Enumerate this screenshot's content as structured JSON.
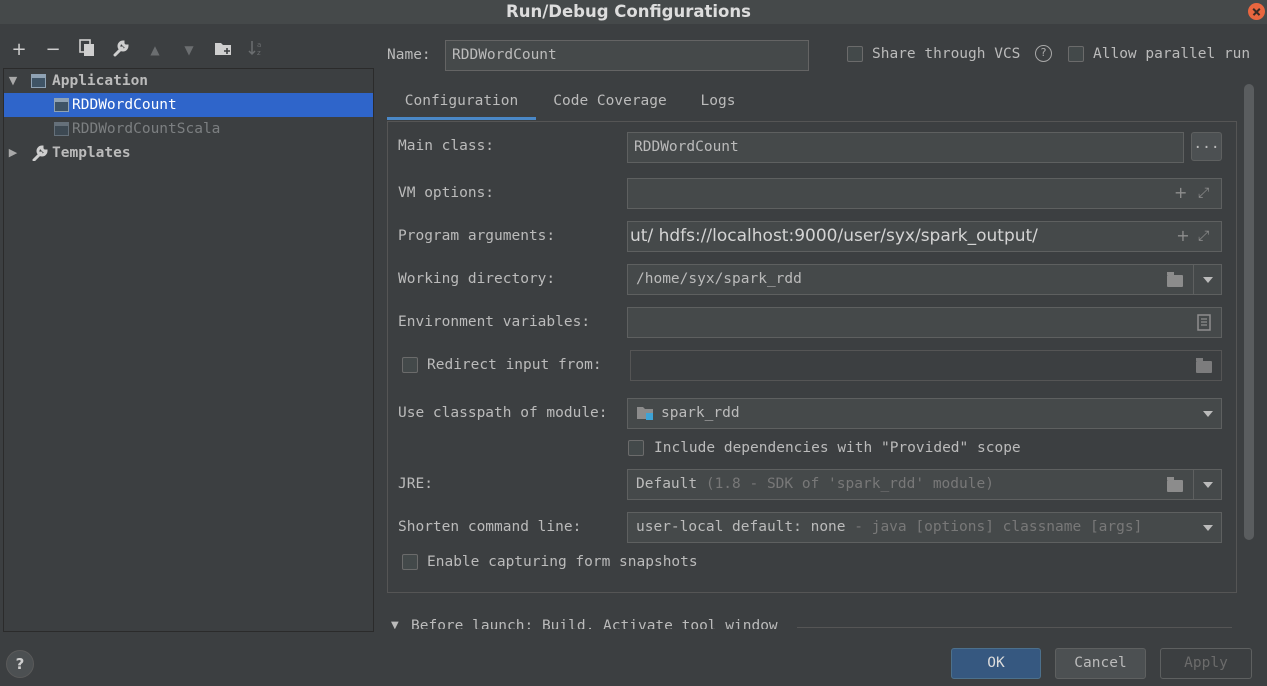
{
  "window": {
    "title": "Run/Debug Configurations"
  },
  "toolbar": {
    "icons": [
      "add-icon",
      "remove-icon",
      "copy-icon",
      "wrench-icon",
      "move-up-icon",
      "move-down-icon",
      "new-folder-icon",
      "sort-icon"
    ]
  },
  "tree": {
    "application_label": "Application",
    "items": [
      {
        "label": "RDDWordCount",
        "selected": true
      },
      {
        "label": "RDDWordCountScala",
        "selected": false
      }
    ],
    "templates_label": "Templates"
  },
  "name_row": {
    "label": "Name:",
    "value": "RDDWordCount",
    "share_vcs_label": "Share through VCS",
    "allow_parallel_label": "Allow parallel run"
  },
  "tabs": [
    {
      "label": "Configuration",
      "active": true
    },
    {
      "label": "Code Coverage",
      "active": false
    },
    {
      "label": "Logs",
      "active": false
    }
  ],
  "form": {
    "main_class_label": "Main class:",
    "main_class_value": "RDDWordCount",
    "browse_label": "...",
    "vm_options_label": "VM options:",
    "vm_options_value": "",
    "program_arguments_label": "Program arguments:",
    "program_arguments_value": "ut/ hdfs://localhost:9000/user/syx/spark_output/",
    "working_directory_label": "Working directory:",
    "working_directory_value": "/home/syx/spark_rdd",
    "env_vars_label": "Environment variables:",
    "env_vars_value": "",
    "redirect_input_label": "Redirect input from:",
    "classpath_label": "Use classpath of module:",
    "classpath_value": "spark_rdd",
    "include_deps_label": "Include dependencies with \"Provided\" scope",
    "jre_label": "JRE:",
    "jre_value": "Default",
    "jre_hint": "(1.8 - SDK of 'spark_rdd' module)",
    "shorten_label": "Shorten command line:",
    "shorten_value": "user-local default: none",
    "shorten_hint": "- java [options] classname [args]",
    "snapshots_label": "Enable capturing form snapshots"
  },
  "before_launch": {
    "label": "Before launch: Build, Activate tool window"
  },
  "buttons": {
    "ok": "OK",
    "cancel": "Cancel",
    "apply": "Apply",
    "help": "?"
  },
  "colors": {
    "selection": "#2f65ca",
    "tab_underline": "#4a88c7",
    "primary_button": "#365880",
    "close_button": "#e9663f"
  }
}
